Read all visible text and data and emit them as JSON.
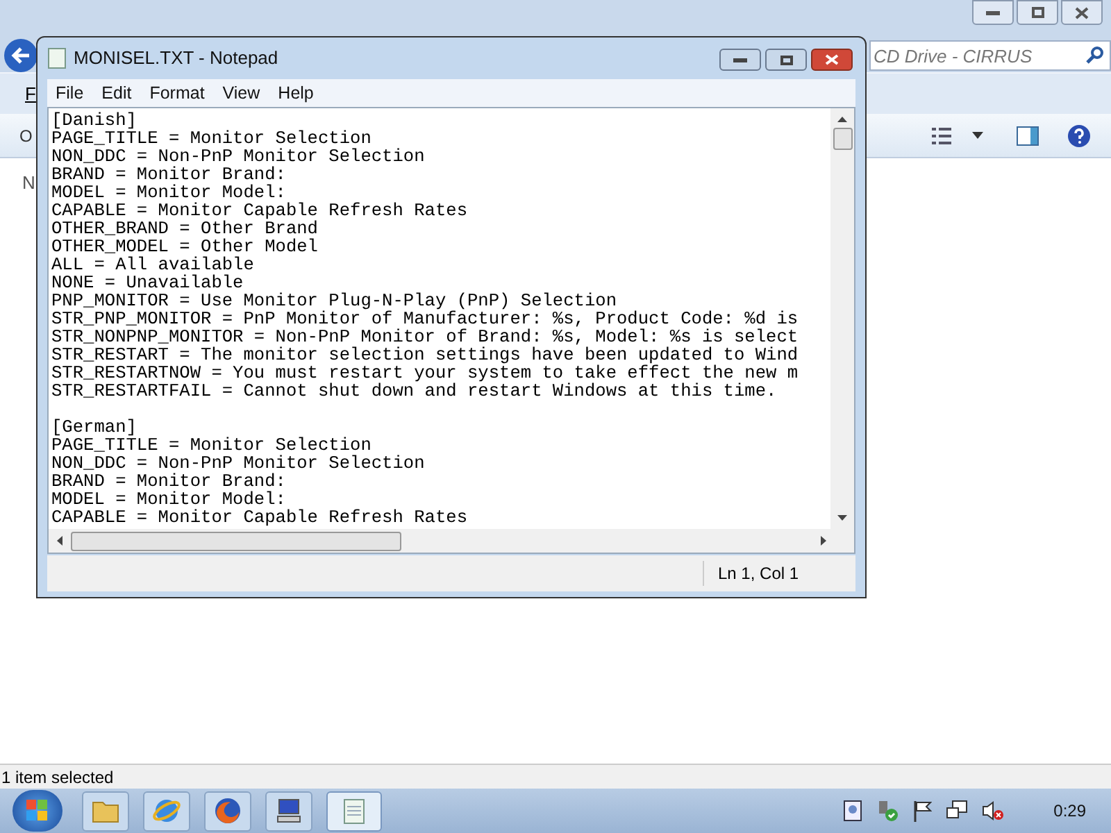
{
  "explorer": {
    "search": {
      "placeholder": "CD Drive - CIRRUS"
    },
    "menu_letter": "F",
    "toolbar_letter": "O",
    "nav_letter": "N",
    "status": "1 item selected"
  },
  "notepad": {
    "title": "MONISEL.TXT - Notepad",
    "menu": [
      "File",
      "Edit",
      "Format",
      "View",
      "Help"
    ],
    "sections": [
      {
        "header": "[Danish]",
        "lines": [
          "PAGE_TITLE = Monitor Selection",
          "NON_DDC = Non-PnP Monitor Selection",
          "BRAND = Monitor Brand:",
          "MODEL = Monitor Model:",
          "CAPABLE = Monitor Capable Refresh Rates",
          "OTHER_BRAND = Other Brand",
          "OTHER_MODEL = Other Model",
          "ALL = All available",
          "NONE = Unavailable",
          "PNP_MONITOR = Use Monitor Plug-N-Play (PnP) Selection",
          "STR_PNP_MONITOR = PnP Monitor of Manufacturer: %s, Product Code: %d is",
          "STR_NONPNP_MONITOR = Non-PnP Monitor of Brand: %s, Model: %s is select",
          "STR_RESTART = The monitor selection settings have been updated to Wind",
          "STR_RESTARTNOW = You must restart your system to take effect the new m",
          "STR_RESTARTFAIL = Cannot shut down and restart Windows at this time."
        ]
      },
      {
        "header": "[German]",
        "lines": [
          "PAGE_TITLE = Monitor Selection",
          "NON_DDC = Non-PnP Monitor Selection",
          "BRAND = Monitor Brand:",
          "MODEL = Monitor Model:",
          "CAPABLE = Monitor Capable Refresh Rates"
        ]
      }
    ],
    "status": "Ln 1, Col 1"
  },
  "taskbar": {
    "buttons": [
      {
        "kind": "folder",
        "selected": false
      },
      {
        "kind": "browser",
        "selected": false
      },
      {
        "kind": "fox",
        "selected": false
      },
      {
        "kind": "computer",
        "selected": false
      },
      {
        "kind": "notepad",
        "selected": true
      }
    ],
    "clock": "0:29"
  }
}
